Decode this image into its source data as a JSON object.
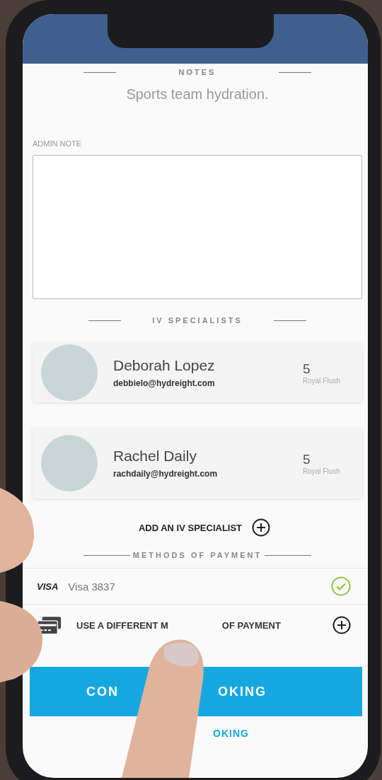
{
  "notes": {
    "heading": "NOTES",
    "text": "Sports team hydration."
  },
  "admin_note": {
    "label": "ADMIN NOTE"
  },
  "specialists": {
    "heading": "IV SPECIALISTS",
    "items": [
      {
        "name": "Deborah Lopez",
        "email": "debbielo@hydreight.com",
        "count": "5",
        "count_label": "Royal Flush"
      },
      {
        "name": "Rachel Daily",
        "email": "rachdaily@hydreight.com",
        "count": "5",
        "count_label": "Royal Flush"
      }
    ],
    "add_label": "ADD AN IV SPECIALIST"
  },
  "payment": {
    "heading": "METHODS OF PAYMENT",
    "methods": [
      {
        "kind": "card",
        "brand": "VISA",
        "label": "Visa 3837",
        "selected": true
      },
      {
        "kind": "add",
        "label_start": "USE A DIFFERENT M",
        "label_end": "OF PAYMENT",
        "selected": false
      }
    ]
  },
  "confirm_button": {
    "label_start": "CON",
    "label_end": "OKING"
  },
  "secondary_link": {
    "label": "OKING"
  }
}
